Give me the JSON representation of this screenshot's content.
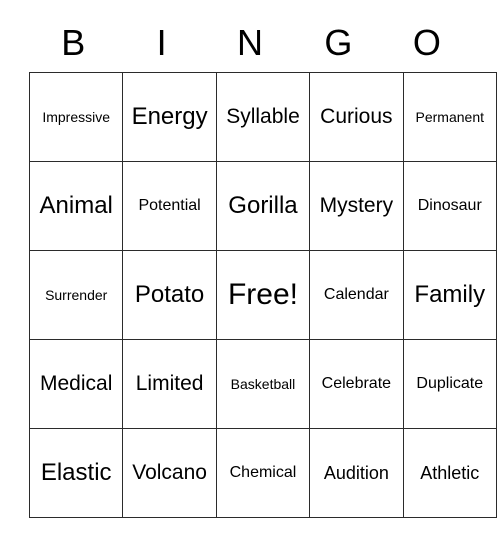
{
  "card": {
    "header_letters": [
      "B",
      "I",
      "N",
      "G",
      "O"
    ],
    "free_space_label": "Free!",
    "rows": [
      [
        {
          "label": "Impressive",
          "size": "s-xxs"
        },
        {
          "label": "Energy",
          "size": "s-lg"
        },
        {
          "label": "Syllable",
          "size": "s-md"
        },
        {
          "label": "Curious",
          "size": "s-md"
        },
        {
          "label": "Permanent",
          "size": "s-xxs"
        }
      ],
      [
        {
          "label": "Animal",
          "size": "s-lg"
        },
        {
          "label": "Potential",
          "size": "s-xs"
        },
        {
          "label": "Gorilla",
          "size": "s-lg"
        },
        {
          "label": "Mystery",
          "size": "s-md"
        },
        {
          "label": "Dinosaur",
          "size": "s-xs"
        }
      ],
      [
        {
          "label": "Surrender",
          "size": "s-xxs"
        },
        {
          "label": "Potato",
          "size": "s-lg"
        },
        {
          "label": "Free!",
          "size": "s-xl"
        },
        {
          "label": "Calendar",
          "size": "s-xs"
        },
        {
          "label": "Family",
          "size": "s-lg"
        }
      ],
      [
        {
          "label": "Medical",
          "size": "s-md"
        },
        {
          "label": "Limited",
          "size": "s-md"
        },
        {
          "label": "Basketball",
          "size": "s-xxs"
        },
        {
          "label": "Celebrate",
          "size": "s-xs"
        },
        {
          "label": "Duplicate",
          "size": "s-xs"
        }
      ],
      [
        {
          "label": "Elastic",
          "size": "s-lg"
        },
        {
          "label": "Volcano",
          "size": "s-md"
        },
        {
          "label": "Chemical",
          "size": "s-xs"
        },
        {
          "label": "Audition",
          "size": "s-sm"
        },
        {
          "label": "Athletic",
          "size": "s-sm"
        }
      ]
    ]
  },
  "colors": {
    "background": "#ffffff",
    "border": "#2b2b2b",
    "text": "#000000"
  }
}
